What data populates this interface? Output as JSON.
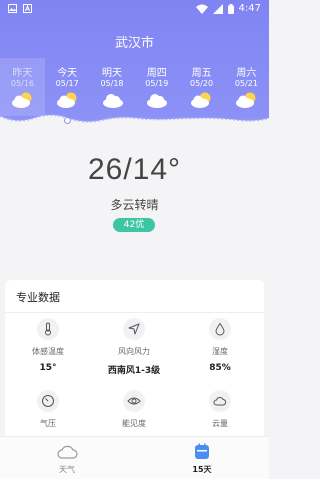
{
  "status_bar": {
    "time": "4:47",
    "colors": {
      "icons": "#ffffff"
    }
  },
  "header": {
    "city": "武汉市",
    "colors": {
      "gradient_top": "#7f84f3",
      "gradient_bottom": "#8d92f6"
    }
  },
  "days": [
    {
      "name": "昨天",
      "date": "05/16",
      "icon": "partly-cloudy-icon"
    },
    {
      "name": "今天",
      "date": "05/17",
      "icon": "partly-cloudy-icon"
    },
    {
      "name": "明天",
      "date": "05/18",
      "icon": "cloudy-icon"
    },
    {
      "name": "周四",
      "date": "05/19",
      "icon": "cloudy-icon"
    },
    {
      "name": "周五",
      "date": "05/20",
      "icon": "partly-cloudy-icon"
    },
    {
      "name": "周六",
      "date": "05/21",
      "icon": "partly-cloudy-icon"
    }
  ],
  "current": {
    "temperature": "26/14°",
    "description": "多云转晴",
    "aqi": "42优",
    "aqi_color": "#3ec6a4"
  },
  "pro_data": {
    "title": "专业数据",
    "items": [
      {
        "label": "体感温度",
        "value": "15°",
        "icon": "thermometer-icon"
      },
      {
        "label": "风向风力",
        "value": "西南风1-3级",
        "icon": "wind-direction-icon"
      },
      {
        "label": "湿度",
        "value": "85%",
        "icon": "humidity-drop-icon"
      },
      {
        "label": "气压",
        "value": "",
        "icon": "pressure-gauge-icon"
      },
      {
        "label": "能见度",
        "value": "",
        "icon": "visibility-eye-icon"
      },
      {
        "label": "云量",
        "value": "",
        "icon": "cloud-cover-icon"
      }
    ]
  },
  "bottom_nav": {
    "items": [
      {
        "label": "天气",
        "icon": "weather-cloud-icon",
        "active": false
      },
      {
        "label": "15天",
        "icon": "calendar-icon",
        "active": true
      }
    ],
    "active_color": "#4a8ef0"
  }
}
